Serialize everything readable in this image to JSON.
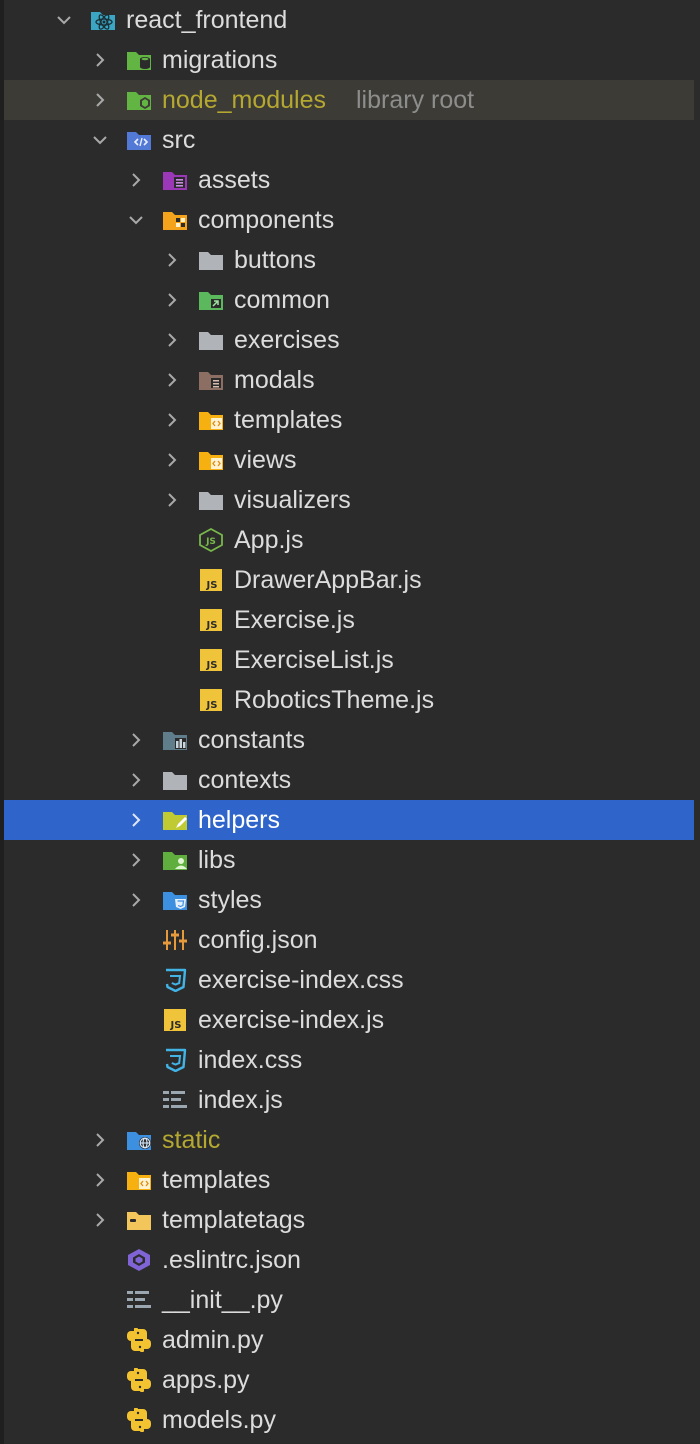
{
  "tree": {
    "root": {
      "label": "react_frontend"
    },
    "migrations": {
      "label": "migrations"
    },
    "node_modules": {
      "label": "node_modules",
      "hint": "library root"
    },
    "src": {
      "label": "src"
    },
    "assets": {
      "label": "assets"
    },
    "components": {
      "label": "components"
    },
    "buttons": {
      "label": "buttons"
    },
    "common": {
      "label": "common"
    },
    "exercises": {
      "label": "exercises"
    },
    "modals": {
      "label": "modals"
    },
    "templates_c": {
      "label": "templates"
    },
    "views": {
      "label": "views"
    },
    "visualizers": {
      "label": "visualizers"
    },
    "app_js": {
      "label": "App.js"
    },
    "drawer": {
      "label": "DrawerAppBar.js"
    },
    "exercise_js": {
      "label": "Exercise.js"
    },
    "exerciselist": {
      "label": "ExerciseList.js"
    },
    "theme": {
      "label": "RoboticsTheme.js"
    },
    "constants": {
      "label": "constants"
    },
    "contexts": {
      "label": "contexts"
    },
    "helpers": {
      "label": "helpers"
    },
    "libs": {
      "label": "libs"
    },
    "styles": {
      "label": "styles"
    },
    "config": {
      "label": "config.json"
    },
    "ex_css": {
      "label": "exercise-index.css"
    },
    "ex_js": {
      "label": "exercise-index.js"
    },
    "index_css": {
      "label": "index.css"
    },
    "index_js": {
      "label": "index.js"
    },
    "static": {
      "label": "static"
    },
    "templates": {
      "label": "templates"
    },
    "templatetags": {
      "label": "templatetags"
    },
    "eslintrc": {
      "label": ".eslintrc.json"
    },
    "init": {
      "label": "__init__.py"
    },
    "admin": {
      "label": "admin.py"
    },
    "apps": {
      "label": "apps.py"
    },
    "models": {
      "label": "models.py"
    }
  },
  "colors": {
    "background": "#2b2b2b",
    "selection": "#2f65ca",
    "library_row": "#3d3b35",
    "library_text": "#b5a831",
    "hint_text": "#8d8d8d"
  },
  "icons": {
    "expanded": "chevron-down-icon",
    "collapsed": "chevron-right-icon"
  }
}
